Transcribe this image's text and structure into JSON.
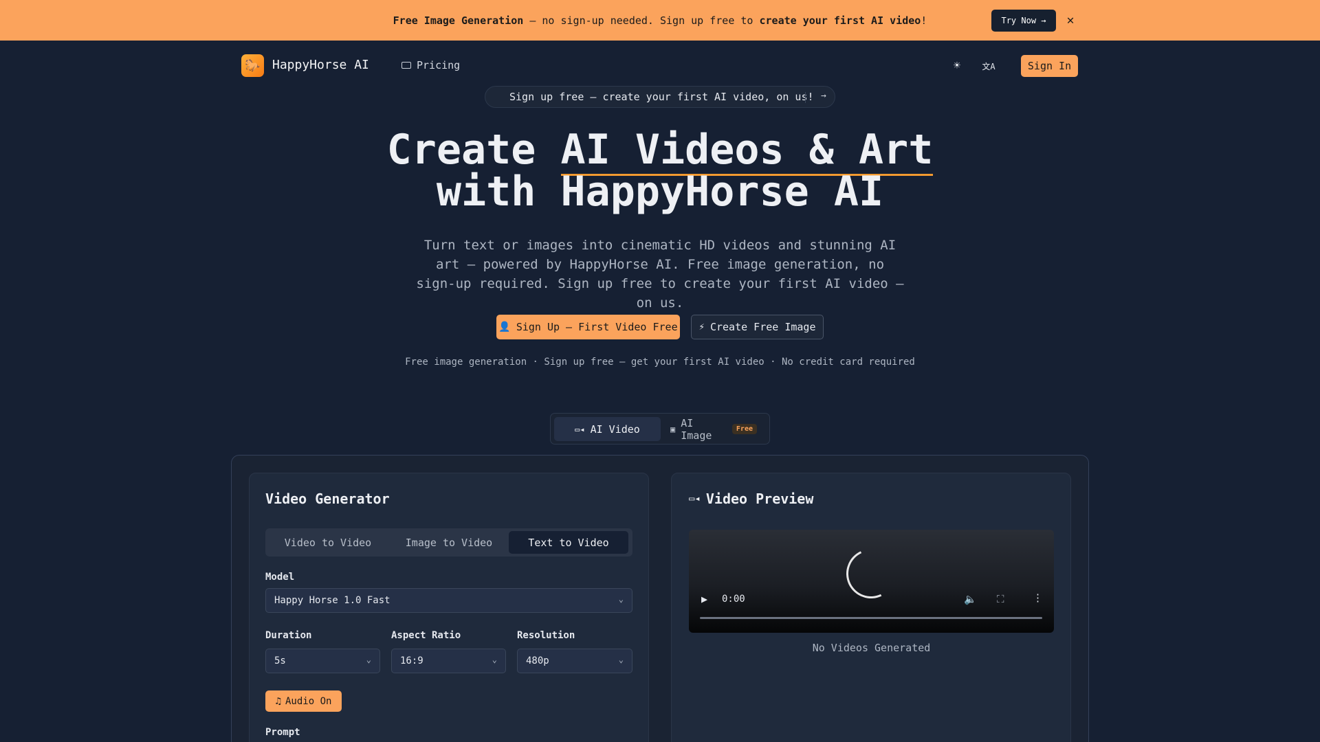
{
  "promo": {
    "bold1": "Free Image Generation",
    "text1": " — no sign-up needed. Sign up free to ",
    "bold2": "create your first AI video",
    "text2": "!",
    "try_label": "Try Now →",
    "close_symbol": "✕"
  },
  "nav": {
    "logo_symbol": "🐎",
    "brand": "HappyHorse AI",
    "pricing": "Pricing",
    "theme_symbol": "☀",
    "lang_symbol": "文A",
    "sign_in": "Sign In"
  },
  "announce": {
    "text": "Sign up free — create your first AI video, on us!",
    "arrow": "→"
  },
  "hero": {
    "line1_a": "Create ",
    "line1_b": "AI Videos & Art",
    "line2": "with HappyHorse AI",
    "subtitle": "Turn text or images into cinematic HD videos and stunning AI art — powered by HappyHorse AI. Free image generation, no sign-up required. Sign up free to create your first AI video — on us."
  },
  "cta": {
    "primary": "Sign Up — First Video Free",
    "secondary": "Create Free Image",
    "note": "Free image generation · Sign up free — get your first AI video · No credit card required"
  },
  "mode_tabs": {
    "video": "AI Video",
    "image": "AI Image",
    "image_badge": "Free"
  },
  "generator": {
    "title": "Video Generator",
    "tabs": [
      "Video to Video",
      "Image to Video",
      "Text to Video"
    ],
    "active_tab": "Text to Video",
    "model_label": "Model",
    "model_value": "Happy Horse 1.0 Fast",
    "duration_label": "Duration",
    "duration_value": "5s",
    "aspect_label": "Aspect Ratio",
    "aspect_value": "16:9",
    "resolution_label": "Resolution",
    "resolution_value": "480p",
    "audio_label": "Audio On",
    "prompt_label": "Prompt"
  },
  "preview": {
    "title": "Video Preview",
    "time": "0:00",
    "empty_text": "No Videos Generated"
  },
  "colors": {
    "accent": "#fba35c",
    "background": "#162033",
    "card": "#1f2a3c"
  }
}
